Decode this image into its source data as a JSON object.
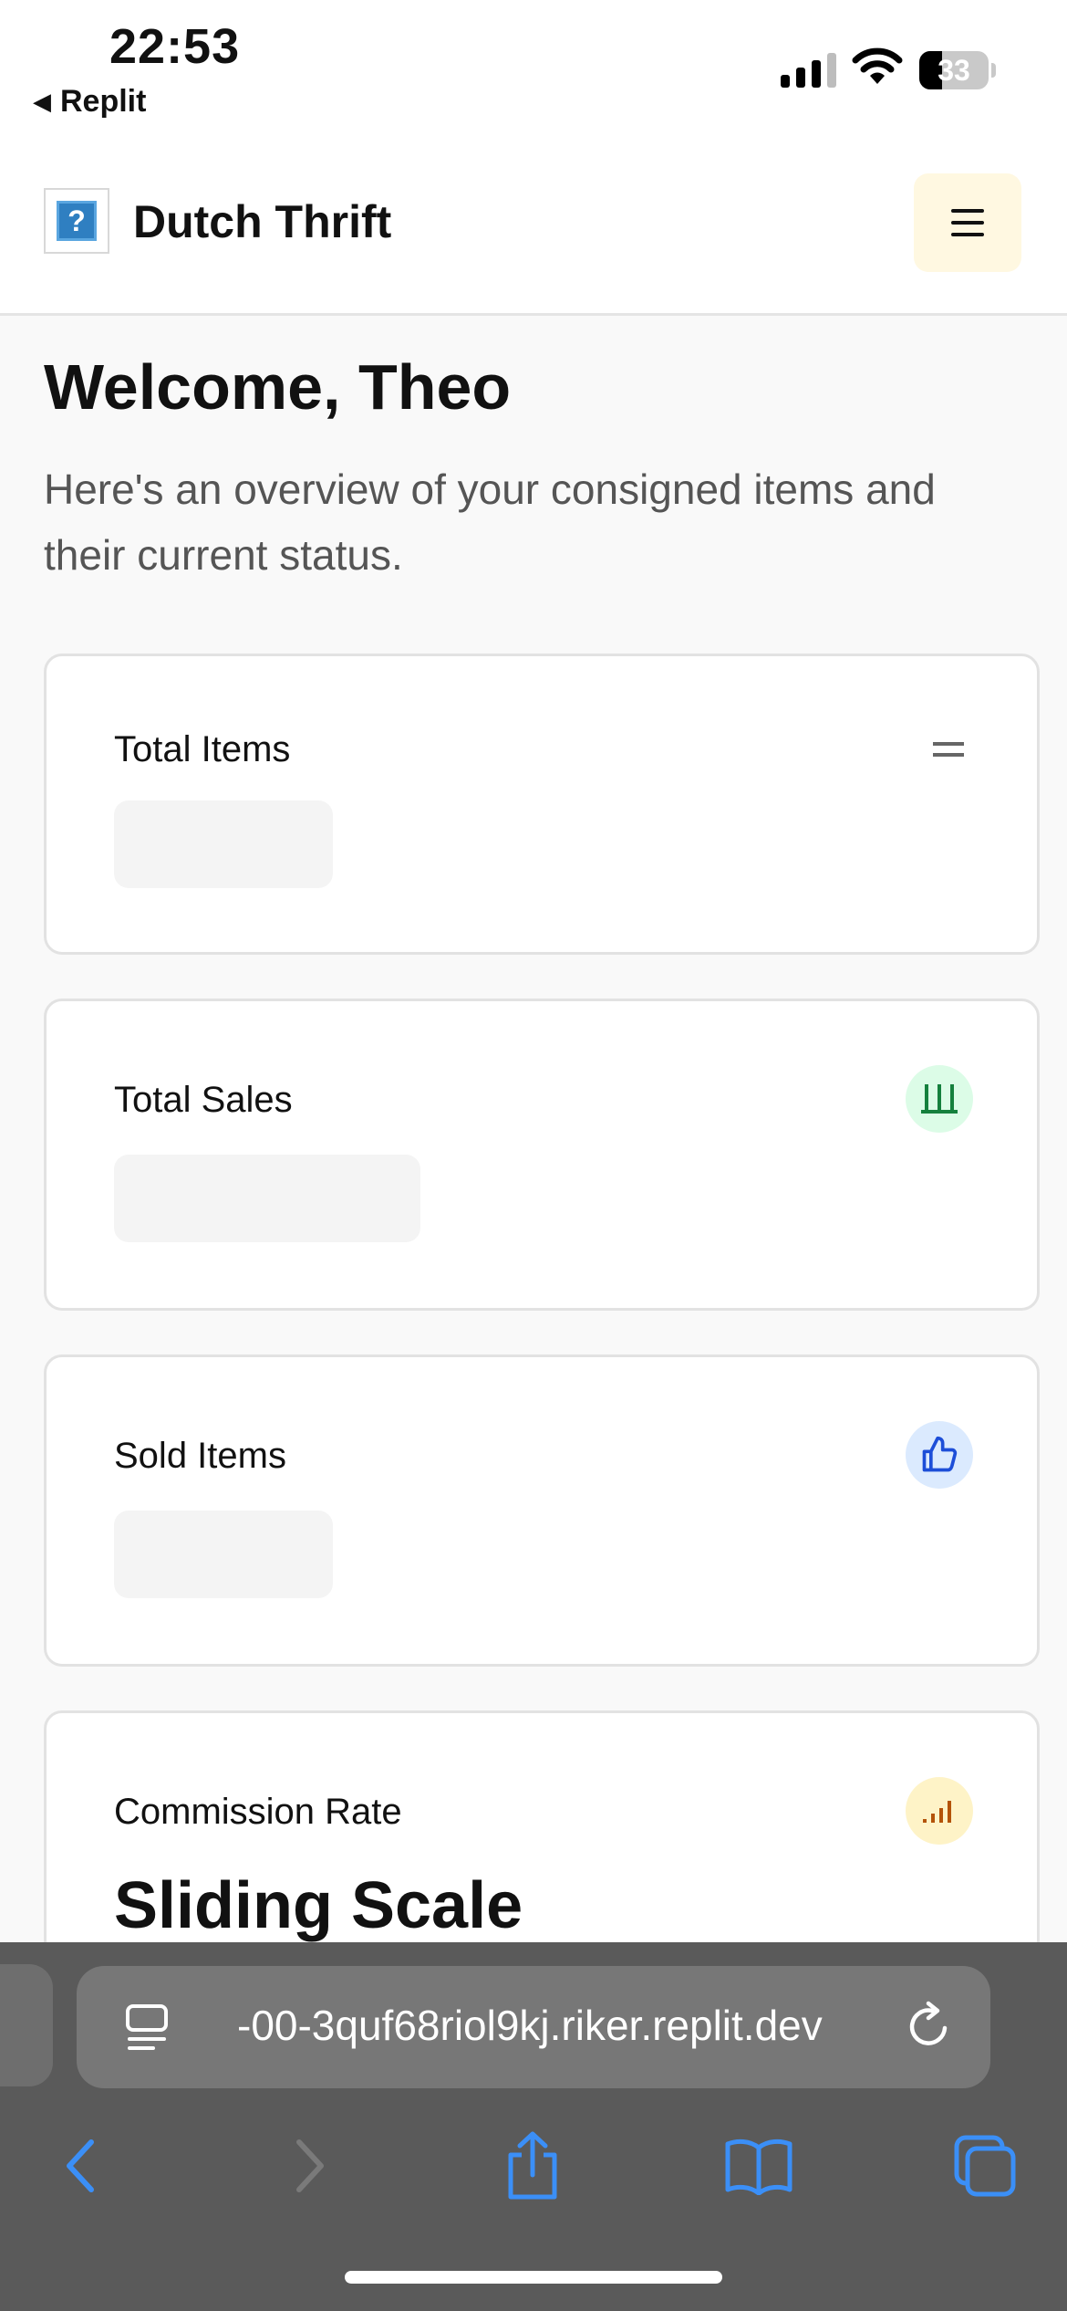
{
  "status_bar": {
    "time": "22:53",
    "back_app": "Replit",
    "battery": "33"
  },
  "header": {
    "brand": "Dutch Thrift",
    "logo_glyph": "?"
  },
  "main": {
    "welcome": "Welcome, Theo",
    "intro": "Here's an overview of your consigned items and their current status.",
    "cards": [
      {
        "label": "Total Items",
        "icon": "equals-icon",
        "value": ""
      },
      {
        "label": "Total Sales",
        "icon": "bars-icon",
        "icon_bg": "#dcfce7",
        "icon_color": "#15803d",
        "value": ""
      },
      {
        "label": "Sold Items",
        "icon": "thumbs-up-icon",
        "icon_bg": "#dbeafe",
        "icon_color": "#1d4ed8",
        "value": ""
      },
      {
        "label": "Commission Rate",
        "icon": "signal-icon",
        "icon_bg": "#fef3c7",
        "icon_color": "#b45309",
        "value": "Sliding Scale"
      }
    ]
  },
  "browser": {
    "url": "-00-3quf68riol9kj.riker.replit.dev",
    "accent": "#3b8ff7"
  }
}
